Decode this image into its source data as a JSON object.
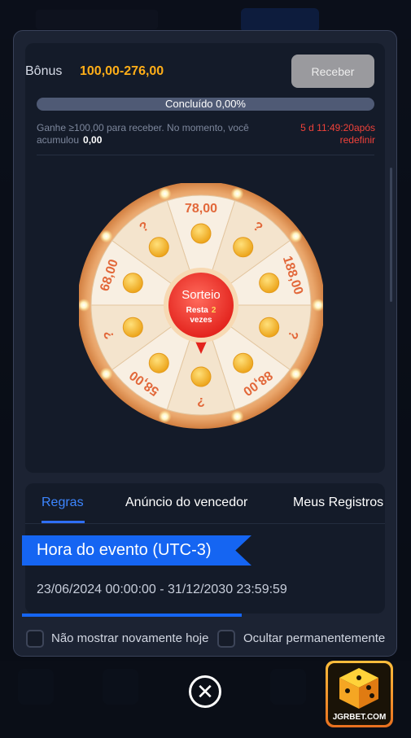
{
  "bonus": {
    "label": "Bônus",
    "range": "100,00-276,00",
    "claim_label": "Receber",
    "progress_text": "Concluído 0,00%",
    "progress_fraction": 0.0,
    "desc_prefix": "Ganhe ≥100,00 para receber. No momento, você acumulou",
    "accumulated": "0,00",
    "timer_line1": "5 d 11:49:20após",
    "timer_line2": "redefinir"
  },
  "wheel": {
    "center_title": "Sorteio",
    "remaining_prefix": "Resta",
    "remaining_count": "2",
    "remaining_suffix": "vezes",
    "segments": [
      "78,00",
      "?",
      "188,00",
      "?",
      "88,00",
      "?",
      "58,00",
      "?",
      "68,00",
      "?"
    ]
  },
  "tabs": [
    {
      "label": "Regras",
      "active": true
    },
    {
      "label": "Anúncio do vencedor",
      "active": false
    },
    {
      "label": "Meus Registros",
      "active": false
    }
  ],
  "event": {
    "heading": "Hora do evento (UTC-3)",
    "dates": "23/06/2024 00:00:00 - 31/12/2030 23:59:59"
  },
  "footer": {
    "hide_today": "Não mostrar novamente hoje",
    "hide_forever": "Ocultar permanentemente"
  },
  "brand": {
    "name": "JGRBET.COM"
  },
  "colors": {
    "accent_blue": "#1565f2",
    "gold": "#ffae18",
    "timer_red": "#f0423a",
    "wheel_label": "#e2683a"
  }
}
